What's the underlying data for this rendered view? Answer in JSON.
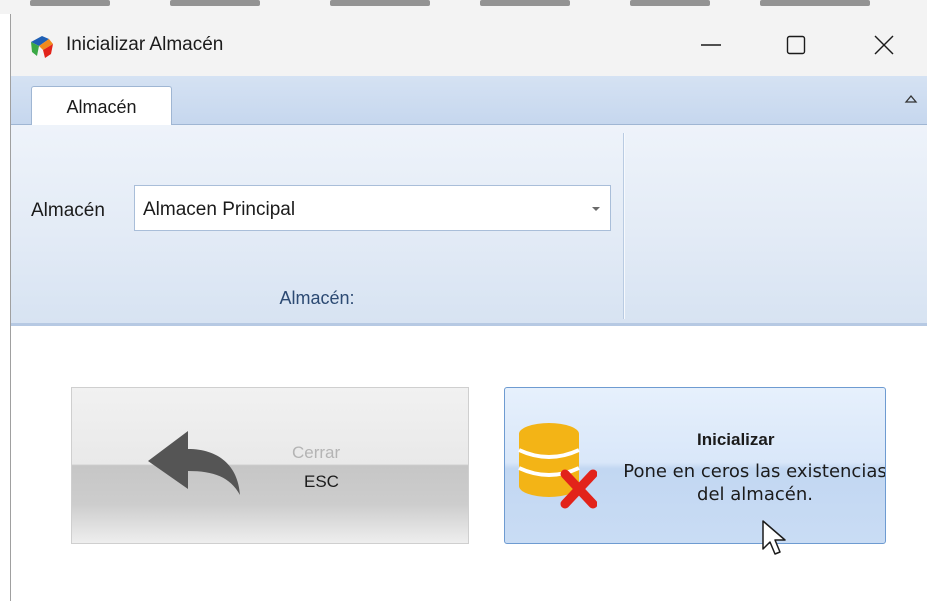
{
  "window": {
    "title": "Inicializar Almacén",
    "controls": [
      "minimize",
      "maximize",
      "close"
    ]
  },
  "ribbon": {
    "tabs": [
      {
        "label": "Almacén",
        "active": true
      }
    ],
    "group": {
      "field_label": "Almacén",
      "combo_value": "Almacen Principal",
      "group_label": "Almacén:"
    }
  },
  "buttons": {
    "cerrar": {
      "label": "Cerrar",
      "shortcut": "ESC",
      "icon": "back-arrow-icon"
    },
    "inicializar": {
      "title": "Inicializar",
      "description": "Pone en ceros las existencias del almacén.",
      "icon": "database-delete-icon"
    }
  },
  "colors": {
    "ribbon_bg": "#dce6f4",
    "accent_border": "#6e9bd1",
    "database_gold": "#f3b416",
    "delete_red": "#e2231a"
  }
}
